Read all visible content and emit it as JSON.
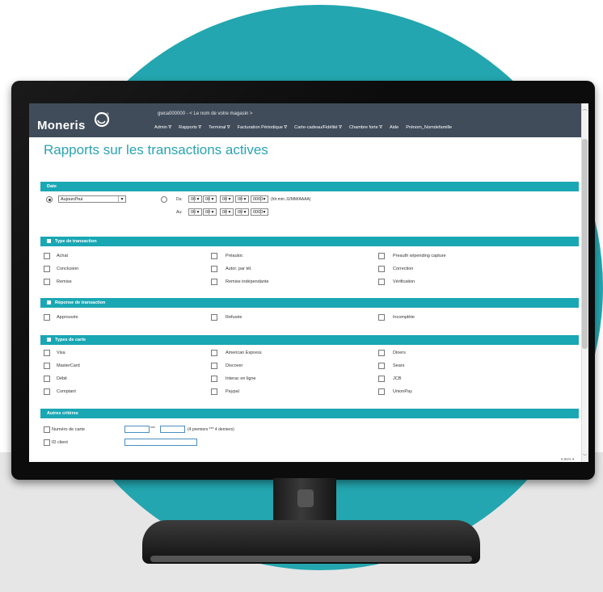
{
  "app": {
    "logo_text": "Moneris",
    "store_line": "gwca000000  -  < Le nom de votre magasin >",
    "nav": [
      {
        "label": "Admin ∇"
      },
      {
        "label": "Rapports ∇"
      },
      {
        "label": "Terminal ∇"
      },
      {
        "label": "Facturation Périodique ∇"
      },
      {
        "label": "Carte-cadeau/Fidélité ∇"
      },
      {
        "label": "Chambre forte ∇"
      },
      {
        "label": "Aide"
      },
      {
        "label": "Prénom_Nomdefamille"
      }
    ],
    "page_title": "Rapports sur les transactions actives",
    "zoom": "5.95% ▾"
  },
  "date_section": {
    "heading": "Date",
    "preset_value": "Aujourd'hui",
    "du_label": "Du:",
    "au_label": "Au:",
    "du": {
      "hh": "00",
      "mm": "00",
      "jj": "00",
      "mo": "00",
      "aaaa": "0000"
    },
    "au": {
      "hh": "00",
      "mm": "00",
      "jj": "00",
      "mo": "00",
      "aaaa": "0000"
    },
    "format_hint": "(hh:mm JJ/MM/AAAA)"
  },
  "type_transaction": {
    "heading": "Type de transaction",
    "col1": [
      "Achat",
      "Conclusion",
      "Remise"
    ],
    "col2": [
      "Préautor.",
      "Autor. par tél.",
      "Remise indépendante"
    ],
    "col3": [
      "Preauth w/pending capture",
      "Correction",
      "Vérification"
    ]
  },
  "reponse_transaction": {
    "heading": "Réponse de transaction",
    "col1": [
      "Approuvée"
    ],
    "col2": [
      "Refusée"
    ],
    "col3": [
      "Incomplète"
    ]
  },
  "types_carte": {
    "heading": "Types de carte",
    "col1": [
      "Visa",
      "MasterCard",
      "Débit",
      "Comptant"
    ],
    "col2": [
      "American Express",
      "Discover",
      "Interac en ligne",
      "Paypal"
    ],
    "col3": [
      "Diners",
      "Sears",
      "JCB",
      "UnionPay"
    ]
  },
  "autres_criteres": {
    "heading": "Autres critères",
    "card_number_label": "Numéro de carte",
    "card_mask": "***",
    "card_hint": "(4 premiers *** 4 derniers)",
    "client_id_label": "ID client"
  }
}
